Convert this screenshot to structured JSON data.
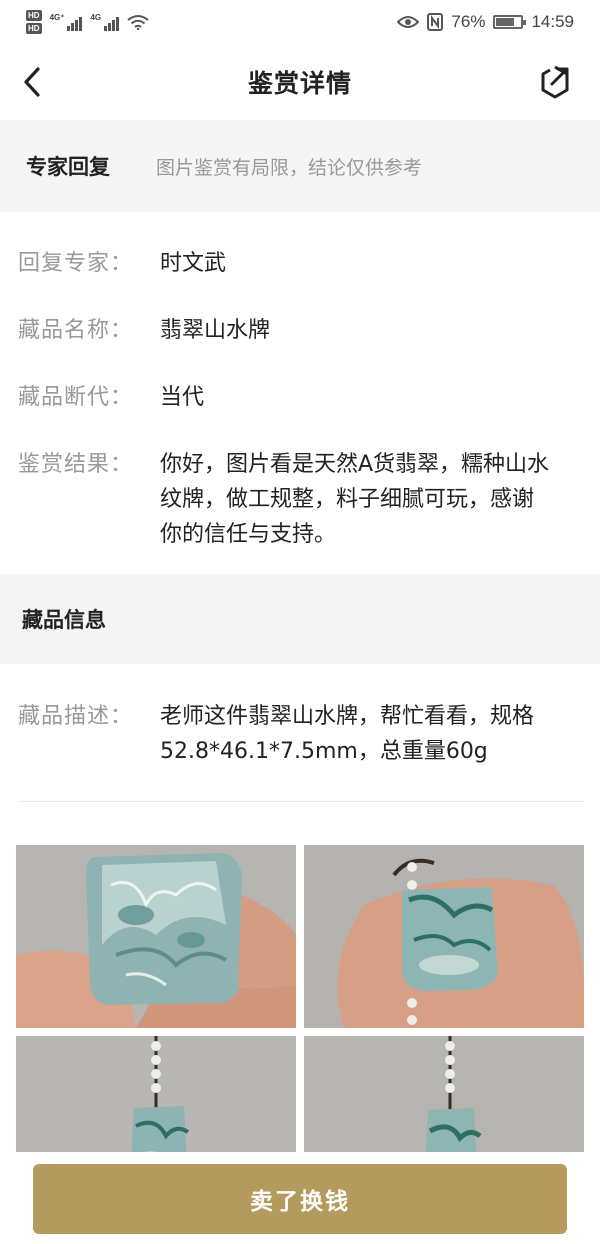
{
  "status_bar": {
    "hd1": "HD",
    "hd2": "HD",
    "net1": "4G⁺",
    "net2": "4G",
    "battery": "76%",
    "battery_level": 0.76,
    "time": "14:59"
  },
  "nav": {
    "title": "鉴赏详情",
    "back_icon": "chevron-left-icon",
    "share_icon": "share-icon"
  },
  "expert_section": {
    "title": "专家回复",
    "note": "图片鉴赏有局限，结论仅供参考"
  },
  "details": [
    {
      "label": "回复专家：",
      "value": "时文武"
    },
    {
      "label": "藏品名称：",
      "value": "翡翠山水牌"
    },
    {
      "label": "藏品断代：",
      "value": "当代"
    },
    {
      "label": "鉴赏结果：",
      "value": "你好，图片看是天然A货翡翠，糯种山水纹牌，做工规整，料子细腻可玩，感谢你的信任与支持。"
    }
  ],
  "item_section": {
    "title": "藏品信息"
  },
  "description": {
    "label": "藏品描述：",
    "value": "老师这件翡翠山水牌，帮忙看看，规格52.8*46.1*7.5mm，总重量60g"
  },
  "photos": [
    {
      "name": "jade-photo-closeup"
    },
    {
      "name": "jade-photo-front"
    },
    {
      "name": "jade-photo-pendant-left"
    },
    {
      "name": "jade-photo-pendant-right"
    }
  ],
  "action": {
    "sell_label": "卖了换钱"
  },
  "colors": {
    "accent": "#b59a5e",
    "band": "#f5f5f5",
    "label": "#999999"
  }
}
